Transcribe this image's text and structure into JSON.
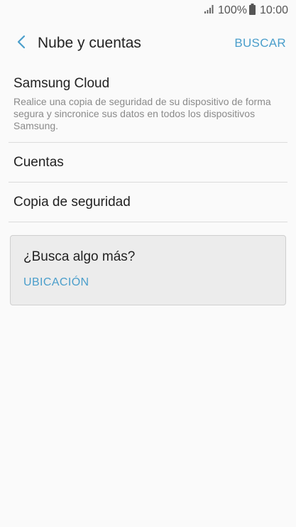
{
  "status_bar": {
    "battery_percent": "100%",
    "time": "10:00",
    "icons": [
      "signal-icon",
      "battery-icon"
    ]
  },
  "app_bar": {
    "title": "Nube y cuentas",
    "search_label": "BUSCAR",
    "back_icon": "chevron-left-icon"
  },
  "list": {
    "samsung_cloud": {
      "title": "Samsung Cloud",
      "subtitle": "Realice una copia de seguridad de su dispositivo de forma segura y sincronice sus datos en todos los dispositivos Samsung."
    },
    "accounts": {
      "title": "Cuentas"
    },
    "backup": {
      "title": "Copia de seguridad"
    }
  },
  "suggestion": {
    "title": "¿Busca algo más?",
    "link": "UBICACIÓN"
  },
  "colors": {
    "accent": "#4a9ecb",
    "background": "#fafafa",
    "card": "#ececec",
    "divider": "#dcdcdc"
  }
}
